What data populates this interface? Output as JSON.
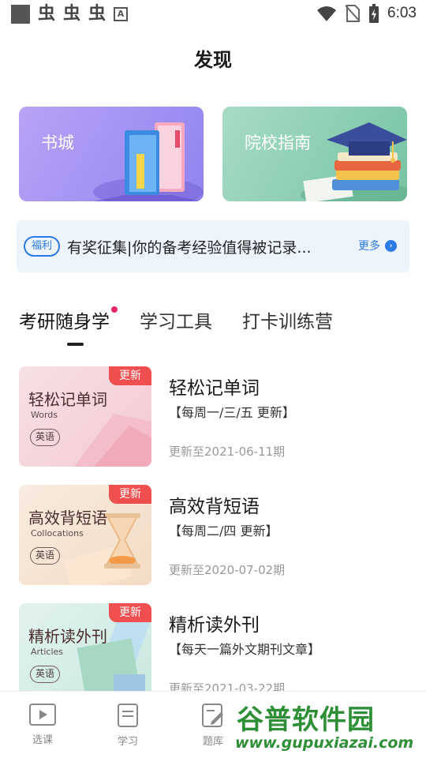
{
  "status_bar": {
    "time": "6:03",
    "notification_icons": [
      "square-icon",
      "bug-icon",
      "bug-icon",
      "bug-icon",
      "text-icon"
    ],
    "bug_glyph": "虫",
    "text_icon_glyph": "A"
  },
  "header": {
    "title": "发现"
  },
  "cards": [
    {
      "label": "书城",
      "icon": "books-illustration"
    },
    {
      "label": "院校指南",
      "icon": "graduation-cap-illustration"
    }
  ],
  "notice": {
    "tag": "福利",
    "text": "有奖征集|你的备考经验值得被记录...",
    "more": "更多"
  },
  "tabs": [
    {
      "label": "考研随身学",
      "active": true,
      "dot": true
    },
    {
      "label": "学习工具",
      "active": false
    },
    {
      "label": "打卡训练营",
      "active": false
    }
  ],
  "courses": [
    {
      "thumb_title": "轻松记单词",
      "thumb_sub": "Words",
      "thumb_lang": "英语",
      "badge": "更新",
      "title": "轻松记单词",
      "schedule": "【每周一/三/五 更新】",
      "updated": "更新至2021-06-11期"
    },
    {
      "thumb_title": "高效背短语",
      "thumb_sub": "Collocations",
      "thumb_lang": "英语",
      "badge": "更新",
      "title": "高效背短语",
      "schedule": "【每周二/四 更新】",
      "updated": "更新至2020-07-02期"
    },
    {
      "thumb_title": "精析读外刊",
      "thumb_sub": "Articles",
      "thumb_lang": "英语",
      "badge": "更新",
      "title": "精析读外刊",
      "schedule": "【每天一篇外文期刊文章】",
      "updated": "更新至2021-03-22期"
    }
  ],
  "bottom_nav": [
    {
      "label": "选课",
      "icon": "play-icon"
    },
    {
      "label": "学习",
      "icon": "document-icon"
    },
    {
      "label": "题库",
      "icon": "edit-icon"
    }
  ],
  "watermark": {
    "title": "谷普软件园",
    "url": "www.gupuxiazai.com"
  },
  "colors": {
    "accent": "#2c7be5",
    "badge": "#f04f4f",
    "tab_dot": "#e5246a",
    "card_book": "#9d8ff2",
    "card_school": "#86caac",
    "watermark": "#2f8f36"
  }
}
